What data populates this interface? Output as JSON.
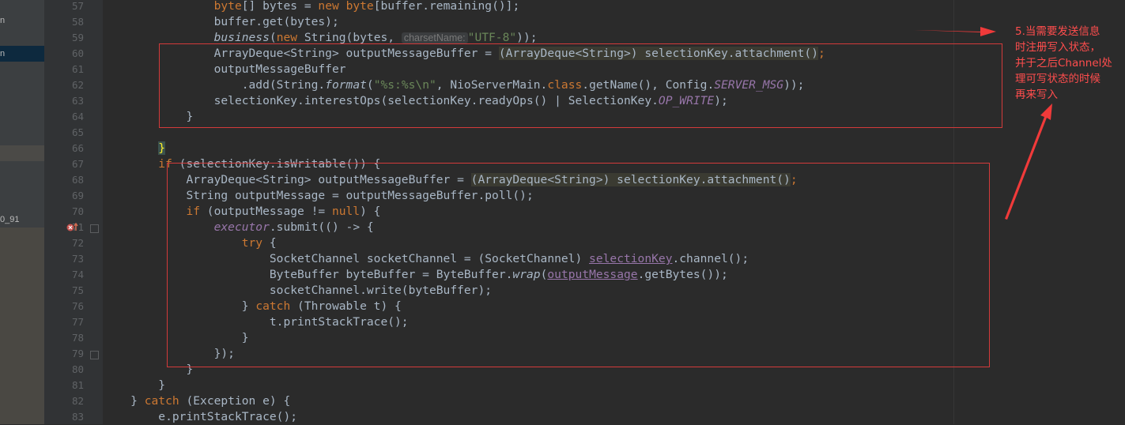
{
  "left_panel": {
    "items": [
      {
        "label": "n"
      },
      {
        "label": "n"
      },
      {
        "label": "0_91"
      }
    ]
  },
  "line_numbers": [
    "57",
    "58",
    "59",
    "60",
    "61",
    "62",
    "63",
    "64",
    "65",
    "66",
    "67",
    "68",
    "69",
    "70",
    "71",
    "72",
    "73",
    "74",
    "75",
    "76",
    "77",
    "78",
    "79",
    "80",
    "81",
    "82",
    "83"
  ],
  "code": {
    "l57": {
      "t1": "byte",
      "t2": "[] bytes = ",
      "t3": "new",
      "t4": " ",
      "t5": "byte",
      "t6": "[buffer.remaining()];"
    },
    "l58": {
      "t1": "buffer.get(bytes);"
    },
    "l59": {
      "t1": "business",
      "t2": "(",
      "t3": "new",
      "t4": " String(bytes, ",
      "hint": "charsetName:",
      "str": "\"UTF-8\"",
      "t5": "));"
    },
    "l60": {
      "t1": "ArrayDeque<String> outputMessageBuffer = ",
      "hl": "(ArrayDeque<String>) selectionKey.attachment()",
      "t2": ";"
    },
    "l61": {
      "t1": "outputMessageBuffer"
    },
    "l62": {
      "t1": ".add(String.",
      "fn": "format",
      "t2": "(",
      "str": "\"%s:%s\\n\"",
      "t3": ", NioServerMain.",
      "kw": "class",
      "t4": ".getName(), Config.",
      "cst": "SERVER_MSG",
      "t5": "));"
    },
    "l63": {
      "t1": "selectionKey.interestOps(selectionKey.readyOps() | SelectionKey.",
      "cst": "OP_WRITE",
      "t2": ");"
    },
    "l64": {
      "t1": "}"
    },
    "l66": {
      "t1": "}"
    },
    "l67": {
      "kw": "if",
      "t1": " (selectionKey.isWritable()) {"
    },
    "l68": {
      "t1": "ArrayDeque<String> outputMessageBuffer = ",
      "hl": "(ArrayDeque<String>) selectionKey.attachment()",
      "t2": ";"
    },
    "l69": {
      "t1": "String outputMessage = outputMessageBuffer.poll();"
    },
    "l70": {
      "kw": "if",
      "t1": " (outputMessage != ",
      "kw2": "null",
      "t2": ") {"
    },
    "l71": {
      "cst": "executor",
      "t1": ".submit(() -> {"
    },
    "l72": {
      "kw": "try",
      "t1": " {"
    },
    "l73": {
      "t1": "SocketChannel socketChannel = (SocketChannel) ",
      "pv": "selectionKey",
      "t2": ".channel();"
    },
    "l74": {
      "t1": "ByteBuffer byteBuffer = ByteBuffer.",
      "fn": "wrap",
      "t2": "(",
      "pv": "outputMessage",
      "t3": ".getBytes());"
    },
    "l75": {
      "t1": "socketChannel.write(byteBuffer);"
    },
    "l76": {
      "t1": "} ",
      "kw": "catch",
      "t2": " (Throwable t) {"
    },
    "l77": {
      "t1": "t.printStackTrace();"
    },
    "l78": {
      "t1": "}"
    },
    "l79": {
      "t1": "});"
    },
    "l80": {
      "t1": "}"
    },
    "l81": {
      "t1": "}"
    },
    "l82": {
      "t1": "} ",
      "kw": "catch",
      "t2": " (Exception e) {"
    },
    "l83": {
      "t1": "e.printStackTrace();"
    }
  },
  "annotation": {
    "lines": [
      "5.当需要发送信息",
      "时注册写入状态，",
      "并于之后Channel处",
      "理可写状态的时候",
      "再来写入"
    ]
  },
  "colors": {
    "background": "#2b2b2b",
    "keyword": "#cc7832",
    "string": "#6a8759",
    "constant": "#9876aa",
    "annotation": "#ff4d4d",
    "box": "#d33a3a"
  },
  "icons": {
    "gutter_marker": "breakpoint-lambda-icon",
    "fold": "fold-marker-icon"
  }
}
